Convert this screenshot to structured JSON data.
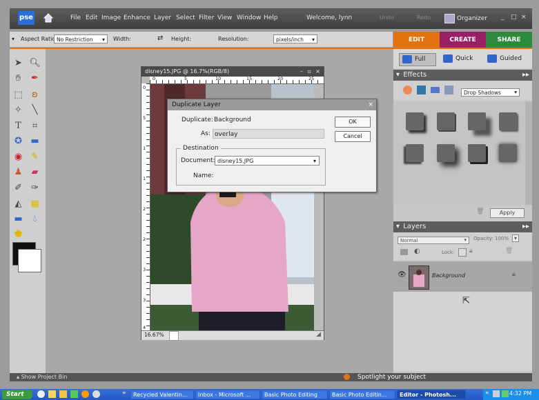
{
  "app": {
    "logo": "pse",
    "welcome": "Welcome, lynn",
    "undo": "Undo",
    "redo": "Redo",
    "organizer": "Organizer",
    "minimize": "_",
    "restore": "□",
    "close": "×"
  },
  "menu": [
    "File",
    "Edit",
    "Image",
    "Enhance",
    "Layer",
    "Select",
    "Filter",
    "View",
    "Window",
    "Help"
  ],
  "options": {
    "aspect_label": "Aspect Ratio:",
    "aspect_value": "No Restriction",
    "width_label": "Width:",
    "height_label": "Height:",
    "resolution_label": "Resolution:",
    "resolution_unit": "pixels/inch"
  },
  "mode_tabs": {
    "edit": "EDIT",
    "create": "CREATE",
    "share": "SHARE"
  },
  "document": {
    "title": "disney15.JPG @ 16.7%(RGB/8)",
    "zoom": "16.67%",
    "ruler_h": [
      "0",
      "5",
      "10",
      "15",
      "20",
      "25"
    ],
    "ruler_v": [
      "0",
      "5",
      "1",
      "1",
      "2",
      "2",
      "3",
      "3",
      "4"
    ]
  },
  "dialog": {
    "title": "Duplicate Layer",
    "duplicate_label": "Duplicate:",
    "duplicate_value": "Background",
    "as_label": "As:",
    "as_value": "overlay",
    "ok": "OK",
    "cancel": "Cancel",
    "destination": "Destination",
    "document_label": "Document:",
    "document_value": "disney15.JPG",
    "name_label": "Name:"
  },
  "panel": {
    "view_tabs": [
      "Full",
      "Quick",
      "Guided"
    ],
    "effects_header": "Effects",
    "effects_filter": "Drop Shadows",
    "apply": "Apply",
    "layers_header": "Layers",
    "blend_mode": "Normal",
    "opacity_label": "Opacity:",
    "opacity_value": "100%",
    "lock_label": "Lock:",
    "layer_name": "Background"
  },
  "bottom": {
    "show_bin": "Show Project Bin",
    "spotlight": "Spotlight your subject"
  },
  "taskbar": {
    "start": "Start",
    "tasks": [
      "Recycled Valentin...",
      "Inbox - Microsoft ...",
      "Basic Photo Editing",
      "Basic Photo Editin...",
      "Editor - Photosh..."
    ],
    "clock": "4:32 PM"
  },
  "colors": {
    "edit_tab": "#e4730f",
    "create_tab": "#9a1f66",
    "share_tab": "#2c8a3c",
    "photo_shirt": "#e6a6c8"
  }
}
